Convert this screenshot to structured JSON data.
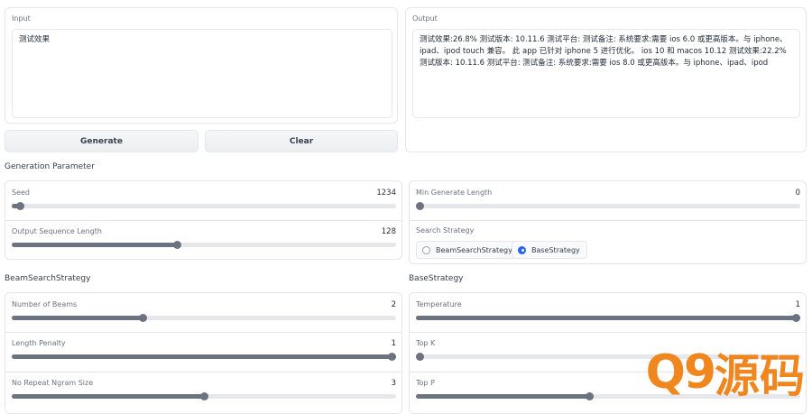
{
  "input": {
    "label": "Input",
    "value": "测试效果"
  },
  "output": {
    "label": "Output",
    "value": "测试效果:26.8% 测试版本: 10.11.6 测试平台: 测试备注: 系统要求:需要 ios 6.0 或更高版本。与 iphone、ipad、ipod touch 兼容。 此 app 已针对 iphone 5 进行优化。 ios 10 和 macos 10.12 测试效果:22.2% 测试版本: 10.11.6 测试平台: 测试备注: 系统要求:需要 ios 8.0 或更高版本。与 iphone、ipad、ipod"
  },
  "buttons": {
    "generate": "Generate",
    "clear": "Clear"
  },
  "generation": {
    "title": "Generation Parameter",
    "seed": {
      "label": "Seed",
      "value": "1234",
      "fraction": 0.02
    },
    "output_len": {
      "label": "Output Sequence Length",
      "value": "128",
      "fraction": 0.43
    },
    "min_len": {
      "label": "Min Generate Length",
      "value": "0",
      "fraction": 0.0
    },
    "search": {
      "label": "Search Strategy",
      "options": [
        "BeamSearchStrategy",
        "BaseStrategy"
      ],
      "selected": "BaseStrategy"
    }
  },
  "beam": {
    "title": "BeamSearchStrategy",
    "num_beams": {
      "label": "Number of Beams",
      "value": "2",
      "fraction": 0.34
    },
    "length_penalty": {
      "label": "Length Penalty",
      "value": "1",
      "fraction": 1.0
    },
    "no_repeat": {
      "label": "No Repeat Ngram Size",
      "value": "3",
      "fraction": 0.5
    }
  },
  "base": {
    "title": "BaseStrategy",
    "temperature": {
      "label": "Temperature",
      "value": "1",
      "fraction": 1.0
    },
    "top_k": {
      "label": "Top K",
      "value": "",
      "fraction": 0.0
    },
    "top_p": {
      "label": "Top P",
      "value": "",
      "fraction": 0.45
    }
  },
  "watermark": {
    "mark": "Q9",
    "text": "源码"
  },
  "colors": {
    "radio_selected": "#2563eb",
    "slider": "#6b7280",
    "watermark": "#f0861e"
  }
}
